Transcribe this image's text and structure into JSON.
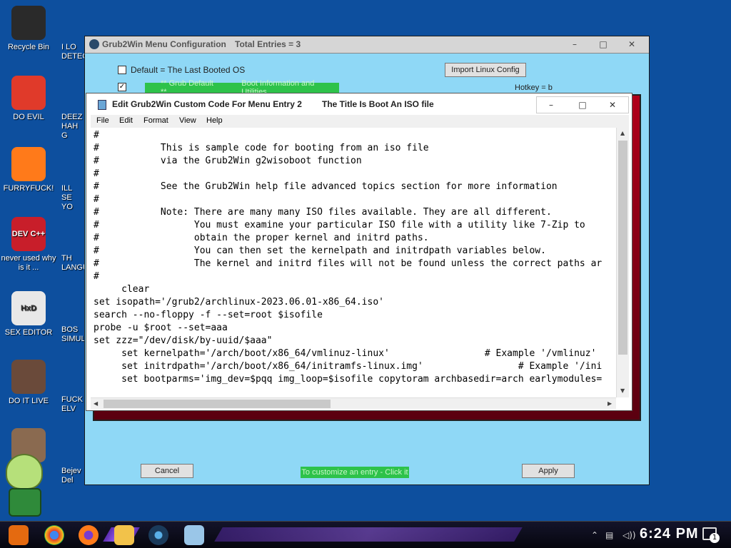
{
  "desktop": {
    "icons": [
      {
        "label": "Recycle Bin",
        "glyph": "",
        "color": "#2a2a2a"
      },
      {
        "label": "DO EVIL",
        "glyph": "",
        "color": "#e03a2a"
      },
      {
        "label": "FURRYFUCK!",
        "glyph": "",
        "color": "#ff7a1a"
      },
      {
        "label": "never used why is it ...",
        "glyph": "DEV C++",
        "color": "#c81e2a"
      },
      {
        "label": "SEX EDITOR",
        "glyph": "HxD",
        "color": "#e8e8e8"
      },
      {
        "label": "DO IT LIVE",
        "glyph": "",
        "color": "#6a4a3a"
      },
      {
        "label": "",
        "glyph": "",
        "color": "#8a6a50"
      }
    ],
    "partial_labels": [
      "I LO DETEC",
      "DEEZ HAH G",
      "ILL SE YO",
      "TH LANGU",
      "BOS SIMUL",
      "FUCK ELV",
      "Bejev Del"
    ]
  },
  "grub2win": {
    "title": "Grub2Win Menu Configuration",
    "total_entries": "Total Entries = 3",
    "default_checkbox_label": "Default = The Last Booted OS",
    "import_button": "Import Linux Config",
    "grub_default": "** Grub Default **",
    "boot_info": "Boot Information and Utilities",
    "hotkey": "Hotkey = b",
    "cancel_button": "Cancel",
    "customize_hint": "To customize an entry - Click it",
    "apply_button": "Apply",
    "controls": {
      "minimize": "–",
      "maximize": "□",
      "close": "✕"
    }
  },
  "editor": {
    "title": "Edit Grub2Win Custom Code For Menu Entry 2",
    "subtitle": "The Title Is Boot An ISO file",
    "controls": {
      "minimize": "–",
      "maximize": "□",
      "close": "✕"
    },
    "menu": [
      "File",
      "Edit",
      "Format",
      "View",
      "Help"
    ],
    "lines": [
      "#",
      "#           This is sample code for booting from an iso file",
      "#           via the Grub2Win g2wisoboot function",
      "#",
      "#           See the Grub2Win help file advanced topics section for more information",
      "#",
      "#           Note: There are many many ISO files available. They are all different.",
      "#                 You must examine your particular ISO file with a utility like 7-Zip to",
      "#                 obtain the proper kernel and initrd paths.",
      "#                 You can then set the kernelpath and initrdpath variables below.",
      "#                 The kernel and initrd files will not be found unless the correct paths ar",
      "#",
      "     clear",
      "set isopath='/grub2/archlinux-2023.06.01-x86_64.iso'",
      "search --no-floppy -f --set=root $isofile",
      "probe -u $root --set=aaa",
      "set zzz=\"/dev/disk/by-uuid/$aaa\"",
      "     set kernelpath='/arch/boot/x86_64/vmlinuz-linux'                 # Example '/vmlinuz'",
      "     set initrdpath='/arch/boot/x86_64/initramfs-linux.img'                 # Example '/ini",
      "     set bootparms='img_dev=$pqq img_loop=$isofile copytoram archbasedir=arch earlymodules="
    ]
  },
  "taskbar": {
    "clock": "6:24 PM",
    "notification_count": "1"
  }
}
